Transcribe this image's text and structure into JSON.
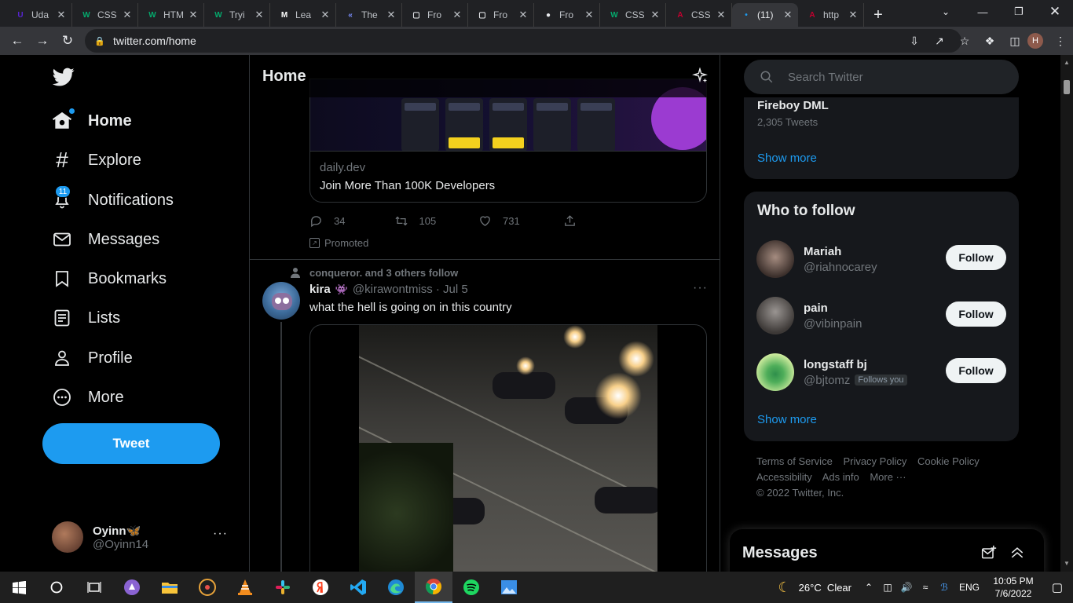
{
  "browser": {
    "tabs": [
      {
        "label": "Uda",
        "fav": "U",
        "color": "#5624d0"
      },
      {
        "label": "CSS",
        "fav": "W",
        "color": "#04aa6d"
      },
      {
        "label": "HTM",
        "fav": "W",
        "color": "#04aa6d"
      },
      {
        "label": "Tryi",
        "fav": "W",
        "color": "#04aa6d"
      },
      {
        "label": "Lea",
        "fav": "M",
        "color": "#ffffff"
      },
      {
        "label": "The",
        "fav": "«",
        "color": "#7b8fff"
      },
      {
        "label": "Fro",
        "fav": "▢",
        "color": "#e8eaed"
      },
      {
        "label": "Fro",
        "fav": "▢",
        "color": "#e8eaed"
      },
      {
        "label": "Fro",
        "fav": "●",
        "color": "#e8eaed"
      },
      {
        "label": "CSS",
        "fav": "W",
        "color": "#04aa6d"
      },
      {
        "label": "CSS",
        "fav": "A",
        "color": "#c3002f"
      },
      {
        "label": "(11)",
        "fav": "•",
        "color": "#1d9bf0",
        "active": true
      },
      {
        "label": "http",
        "fav": "A",
        "color": "#c3002f"
      }
    ],
    "url": "twitter.com/home",
    "profile_initial": "H"
  },
  "nav": {
    "items": [
      {
        "label": "Home",
        "icon": "home-icon"
      },
      {
        "label": "Explore",
        "icon": "hash-icon"
      },
      {
        "label": "Notifications",
        "icon": "bell-icon",
        "badge": "11"
      },
      {
        "label": "Messages",
        "icon": "mail-icon"
      },
      {
        "label": "Bookmarks",
        "icon": "bookmark-icon"
      },
      {
        "label": "Lists",
        "icon": "list-icon"
      },
      {
        "label": "Profile",
        "icon": "person-icon"
      },
      {
        "label": "More",
        "icon": "more-circle-icon"
      }
    ],
    "tweet_label": "Tweet",
    "account": {
      "name": "Oyinn🦋",
      "handle": "@Oyinn14"
    }
  },
  "header": {
    "title": "Home"
  },
  "promo": {
    "domain": "daily.dev",
    "title": "Join More Than 100K Developers",
    "replies": "34",
    "retweets": "105",
    "likes": "731",
    "promoted": "Promoted"
  },
  "tweet": {
    "social": "conqueror. and 3 others follow",
    "name": "kira",
    "emoji": "👾",
    "handle": "@kirawontmiss",
    "date": "· Jul 5",
    "text": "what the hell is going on in this country"
  },
  "right": {
    "search_placeholder": "Search Twitter",
    "trend": {
      "name": "Fireboy DML",
      "count": "2,305 Tweets",
      "show_more": "Show more"
    },
    "who_to_follow": {
      "title": "Who to follow",
      "people": [
        {
          "name": "Mariah",
          "handle": "@riahnocarey",
          "follows_you": "",
          "button": "Follow",
          "avatar": "#3b2f2b"
        },
        {
          "name": "pain",
          "handle": "@vibinpain",
          "follows_you": "",
          "button": "Follow",
          "avatar": "#5a5552"
        },
        {
          "name": "longstaff bj",
          "handle": "@bjtomz",
          "follows_you": "Follows you",
          "button": "Follow",
          "avatar": "#a9d86e"
        }
      ],
      "show_more": "Show more"
    },
    "footer": {
      "line1": [
        "Terms of Service",
        "Privacy Policy",
        "Cookie Policy"
      ],
      "line2": [
        "Accessibility",
        "Ads info",
        "More ···"
      ],
      "copyright": "© 2022 Twitter, Inc."
    },
    "messages_title": "Messages"
  },
  "taskbar": {
    "weather": "26°C  Clear",
    "lang": "ENG",
    "time": "10:05 PM",
    "date": "7/6/2022"
  }
}
